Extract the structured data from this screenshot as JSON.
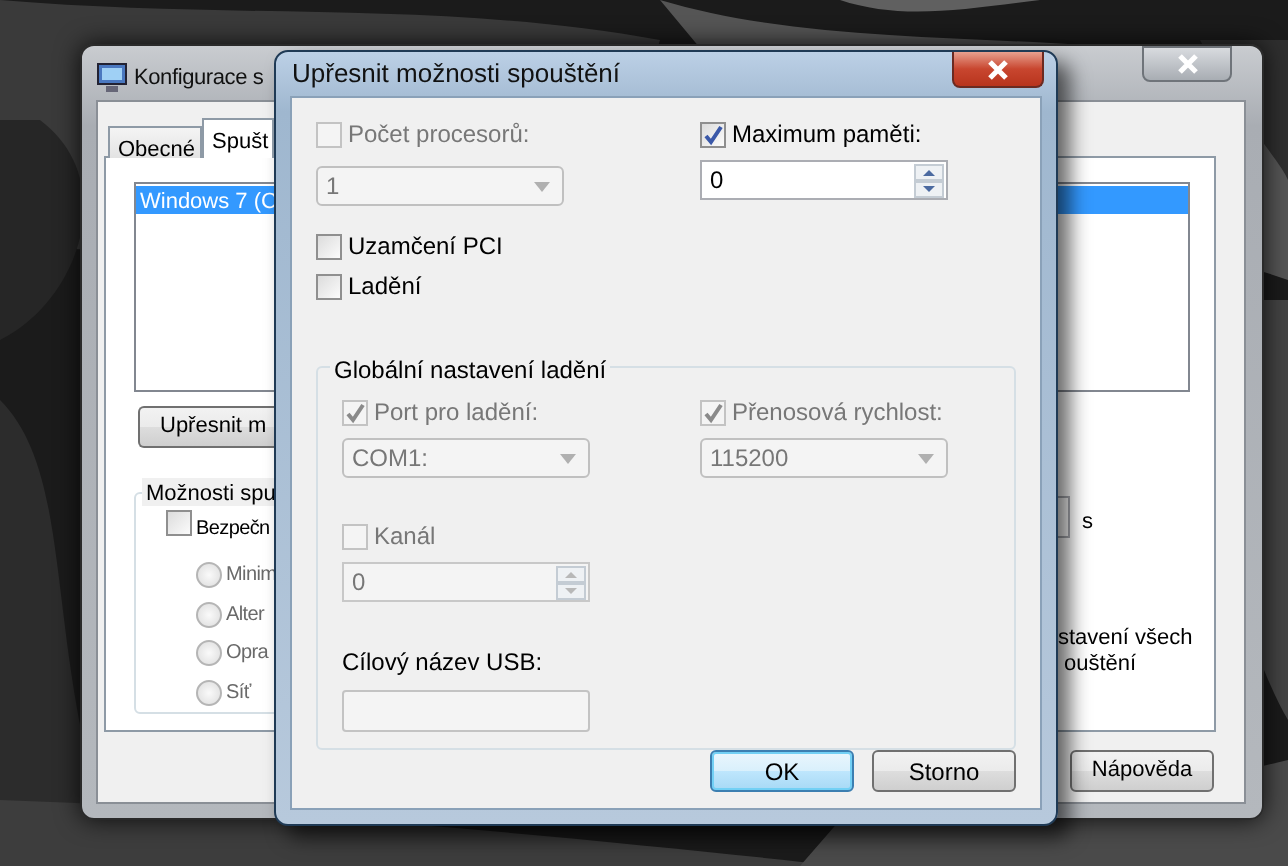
{
  "background_window": {
    "title": "Konfigurace s",
    "tabs": [
      {
        "label": "Obecné",
        "selected": false
      },
      {
        "label": "Spušt",
        "selected": true
      }
    ],
    "boot_list": [
      {
        "label": "Windows 7 (C",
        "selected": true
      }
    ],
    "advanced_button": "Upřesnit m",
    "boot_options": {
      "title": "Možnosti spu",
      "safe_boot": {
        "label": "Bezpečn",
        "checked": false
      },
      "options": [
        {
          "label": "Minim",
          "selected": false,
          "disabled": true
        },
        {
          "label": "Alter",
          "selected": false,
          "disabled": true
        },
        {
          "label": "Opra",
          "selected": false,
          "disabled": true
        },
        {
          "label": "Síť",
          "selected": false,
          "disabled": true
        }
      ]
    },
    "timeout_unit": "s",
    "note_lines": [
      "stavení všech",
      "ouštění"
    ],
    "help_button": "Nápověda"
  },
  "dialog": {
    "title": "Upřesnit možnosti spouštění",
    "processors": {
      "label": "Počet procesorů:",
      "checked": false,
      "value": "1",
      "disabled": true
    },
    "max_memory": {
      "label": "Maximum paměti:",
      "checked": true,
      "value": "0",
      "disabled": false
    },
    "pci_lock": {
      "label": "Uzamčení PCI",
      "checked": false
    },
    "debug": {
      "label": "Ladění",
      "checked": false
    },
    "debug_settings": {
      "title": "Globální nastavení ladění",
      "port": {
        "label": "Port pro ladění:",
        "checked": true,
        "disabled": true,
        "value": "COM1:"
      },
      "baud": {
        "label": "Přenosová rychlost:",
        "checked": true,
        "disabled": true,
        "value": "115200"
      },
      "channel": {
        "label": "Kanál",
        "checked": false,
        "disabled": true,
        "value": "0"
      },
      "usb_target": {
        "label": "Cílový název USB:",
        "disabled": true
      }
    },
    "buttons": [
      {
        "label": "OK",
        "default": true
      },
      {
        "label": "Storno",
        "default": false
      }
    ]
  }
}
